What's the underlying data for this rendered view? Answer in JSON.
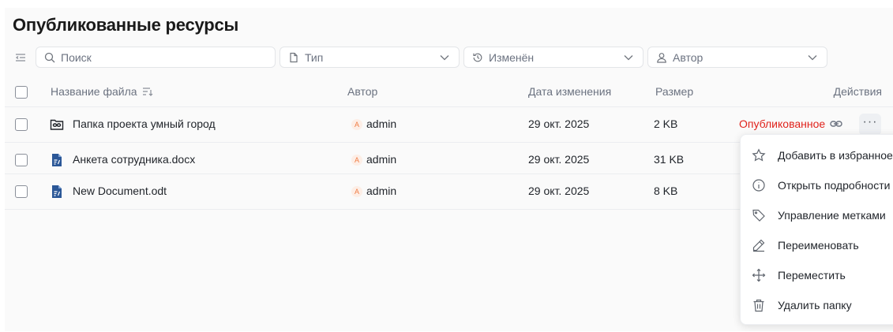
{
  "page": {
    "title": "Опубликованные ресурсы"
  },
  "filters": {
    "search_placeholder": "Поиск",
    "type_label": "Тип",
    "modified_label": "Изменён",
    "author_label": "Автор"
  },
  "table": {
    "columns": {
      "name": "Название файла",
      "author": "Автор",
      "modified": "Дата изменения",
      "size": "Размер",
      "actions": "Действия"
    },
    "rows": [
      {
        "icon": "shared-folder-icon",
        "name": "Папка проекта умный город",
        "author_initial": "A",
        "author": "admin",
        "modified": "29 окт. 2025",
        "size": "2 KB",
        "status": "Опубликованное"
      },
      {
        "icon": "document-icon",
        "name": "Анкета сотрудника.docx",
        "author_initial": "A",
        "author": "admin",
        "modified": "29 окт. 2025",
        "size": "31 KB"
      },
      {
        "icon": "document-icon",
        "name": "New Document.odt",
        "author_initial": "A",
        "author": "admin",
        "modified": "29 окт. 2025",
        "size": "8 KB"
      }
    ]
  },
  "context_menu": {
    "items": [
      {
        "label": "Добавить в избранное",
        "icon": "star-icon"
      },
      {
        "label": "Открыть подробности",
        "icon": "info-icon"
      },
      {
        "label": "Управление метками",
        "icon": "tag-icon"
      },
      {
        "label": "Переименовать",
        "icon": "pencil-icon"
      },
      {
        "label": "Переместить",
        "icon": "move-icon"
      },
      {
        "label": "Удалить папку",
        "icon": "trash-icon"
      }
    ]
  },
  "colors": {
    "published": "#e0231c",
    "doc_icon": "#2b5797",
    "avatar_text": "#f07c44",
    "avatar_bg": "#fdeee6"
  }
}
